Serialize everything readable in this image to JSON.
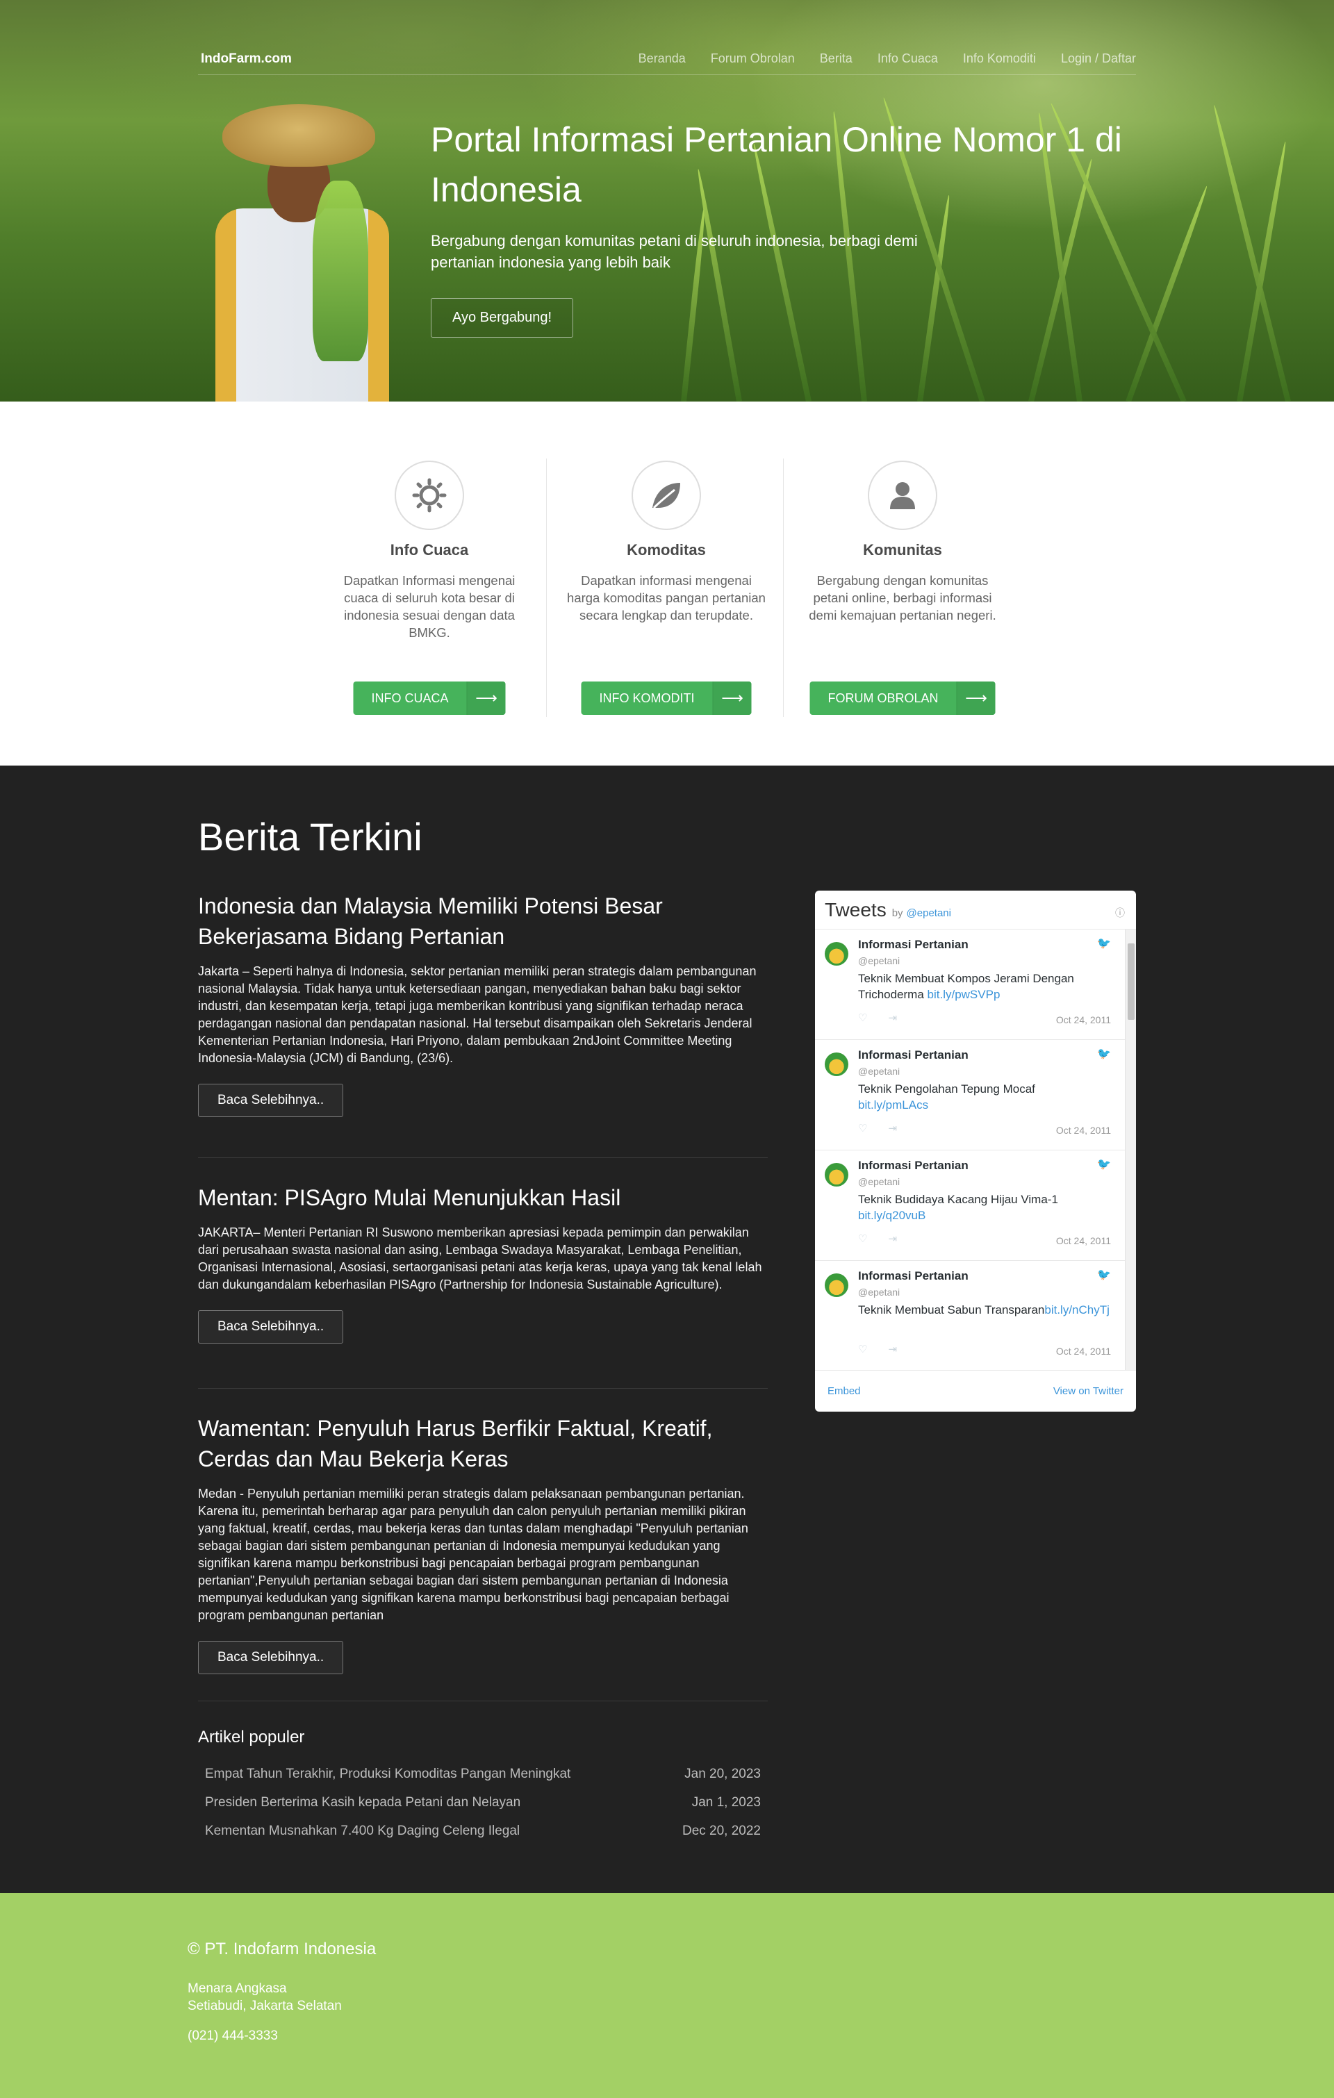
{
  "nav": {
    "brand": "IndoFarm.com",
    "items": [
      "Beranda",
      "Forum Obrolan",
      "Berita",
      "Info Cuaca",
      "Info Komoditi",
      "Login / Daftar"
    ]
  },
  "hero": {
    "title": "Portal Informasi Pertanian Online Nomor 1 di Indonesia",
    "subtitle": "Bergabung dengan komunitas petani di seluruh indonesia, berbagi demi pertanian indonesia yang lebih baik",
    "cta": "Ayo Bergabung!"
  },
  "features": [
    {
      "icon": "sun-icon",
      "title": "Info Cuaca",
      "text": "Dapatkan Informasi mengenai cuaca di seluruh kota besar di indonesia sesuai dengan data BMKG.",
      "button": "INFO CUACA"
    },
    {
      "icon": "leaf-icon",
      "title": "Komoditas",
      "text": "Dapatkan informasi mengenai harga komoditas pangan pertanian secara lengkap dan terupdate.",
      "button": "INFO KOMODITI"
    },
    {
      "icon": "user-icon",
      "title": "Komunitas",
      "text": "Bergabung dengan komunitas petani online, berbagi informasi demi kemajuan pertanian negeri.",
      "button": "FORUM OBROLAN"
    }
  ],
  "news": {
    "heading": "Berita Terkini",
    "read_more": "Baca Selebihnya..",
    "articles": [
      {
        "title": "Indonesia dan Malaysia Memiliki Potensi Besar Bekerjasama Bidang Pertanian",
        "body": "Jakarta – Seperti halnya di Indonesia, sektor pertanian memiliki peran strategis dalam pembangunan nasional Malaysia. Tidak hanya untuk ketersediaan pangan, menyediakan bahan baku bagi sektor industri, dan kesempatan kerja, tetapi juga memberikan kontribusi yang signifikan terhadap neraca perdagangan nasional dan pendapatan nasional. Hal tersebut disampaikan oleh Sekretaris Jenderal Kementerian Pertanian Indonesia, Hari Priyono, dalam pembukaan 2ndJoint Committee Meeting Indonesia-Malaysia (JCM) di Bandung, (23/6)."
      },
      {
        "title": "Mentan: PISAgro Mulai Menunjukkan Hasil",
        "body": "JAKARTA– Menteri Pertanian RI Suswono memberikan apresiasi kepada pemimpin dan perwakilan dari perusahaan swasta nasional dan asing, Lembaga Swadaya Masyarakat, Lembaga Penelitian, Organisasi Internasional, Asosiasi, sertaorganisasi petani atas kerja keras, upaya yang tak kenal lelah dan dukungandalam keberhasilan PISAgro (Partnership for Indonesia Sustainable Agriculture)."
      },
      {
        "title": "Wamentan: Penyuluh Harus Berfikir Faktual, Kreatif, Cerdas dan Mau Bekerja Keras",
        "body": "Medan - Penyuluh pertanian memiliki peran strategis dalam pelaksanaan pembangunan pertanian. Karena itu, pemerintah berharap agar para penyuluh dan calon penyuluh pertanian memiliki pikiran yang faktual, kreatif, cerdas, mau bekerja keras dan tuntas dalam menghadapi \"Penyuluh pertanian sebagai bagian dari sistem pembangunan pertanian di Indonesia mempunyai kedudukan yang signifikan karena mampu berkonstribusi bagi pencapaian berbagai program pembangunan pertanian\",Penyuluh pertanian sebagai bagian dari sistem pembangunan pertanian di Indonesia mempunyai kedudukan yang signifikan karena mampu berkonstribusi bagi pencapaian berbagai program pembangunan pertanian"
      }
    ]
  },
  "popular": {
    "title": "Artikel populer",
    "items": [
      {
        "title": "Empat Tahun Terakhir, Produksi Komoditas Pangan Meningkat",
        "date": "Jan 20, 2023"
      },
      {
        "title": "Presiden Berterima Kasih kepada Petani dan Nelayan",
        "date": "Jan 1, 2023"
      },
      {
        "title": "Kementan Musnahkan 7.400 Kg Daging Celeng Ilegal",
        "date": "Dec 20, 2022"
      }
    ]
  },
  "twitter": {
    "title": "Tweets",
    "by": "by",
    "handle": "@epetani",
    "embed": "Embed",
    "view": "View on Twitter",
    "tweets": [
      {
        "name": "Informasi Pertanian",
        "handle": "@epetani",
        "text": "Teknik Membuat Kompos Jerami Dengan Trichoderma ",
        "link": "bit.ly/pwSVPp",
        "date": "Oct 24, 2011"
      },
      {
        "name": "Informasi Pertanian",
        "handle": "@epetani",
        "text": "Teknik Pengolahan Tepung Mocaf ",
        "link": "bit.ly/pmLAcs",
        "date": "Oct 24, 2011"
      },
      {
        "name": "Informasi Pertanian",
        "handle": "@epetani",
        "text": "Teknik Budidaya Kacang Hijau Vima-1 ",
        "link": "bit.ly/q20vuB",
        "date": "Oct 24, 2011"
      },
      {
        "name": "Informasi Pertanian",
        "handle": "@epetani",
        "text": "Teknik Membuat Sabun Transparan",
        "link": "bit.ly/nChyTj",
        "date": "Oct 24, 2011"
      }
    ]
  },
  "footer": {
    "copyright": "© PT. Indofarm Indonesia",
    "address1": "Menara Angkasa",
    "address2": "Setiabudi, Jakarta Selatan",
    "phone": "(021) 444-3333"
  }
}
